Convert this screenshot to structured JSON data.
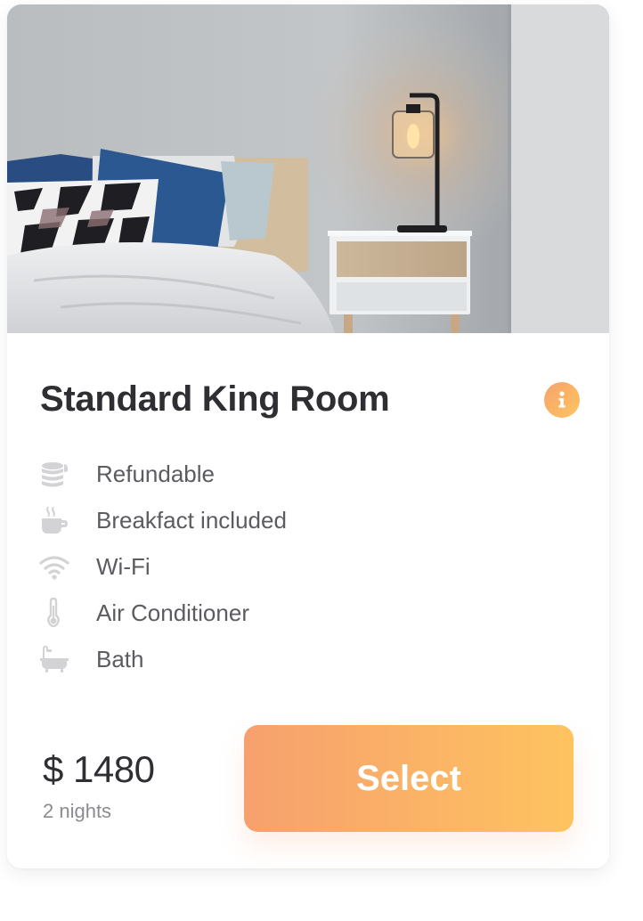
{
  "room": {
    "title": "Standard King Room",
    "info_icon": "info-icon"
  },
  "amenities": [
    {
      "label": "Refundable",
      "icon": "coins-icon"
    },
    {
      "label": "Breakfact included",
      "icon": "coffee-cup-icon"
    },
    {
      "label": "Wi-Fi",
      "icon": "wifi-icon"
    },
    {
      "label": "Air Conditioner",
      "icon": "thermometer-icon"
    },
    {
      "label": "Bath",
      "icon": "bathtub-icon"
    }
  ],
  "pricing": {
    "price": "$ 1480",
    "nights": "2 nights"
  },
  "actions": {
    "select_label": "Select"
  },
  "colors": {
    "accent_start": "#f7a06f",
    "accent_end": "#fec35f",
    "title": "#2f2f33",
    "text": "#5b5b60",
    "muted": "#8c8c90",
    "icon": "#d3d3d6"
  }
}
